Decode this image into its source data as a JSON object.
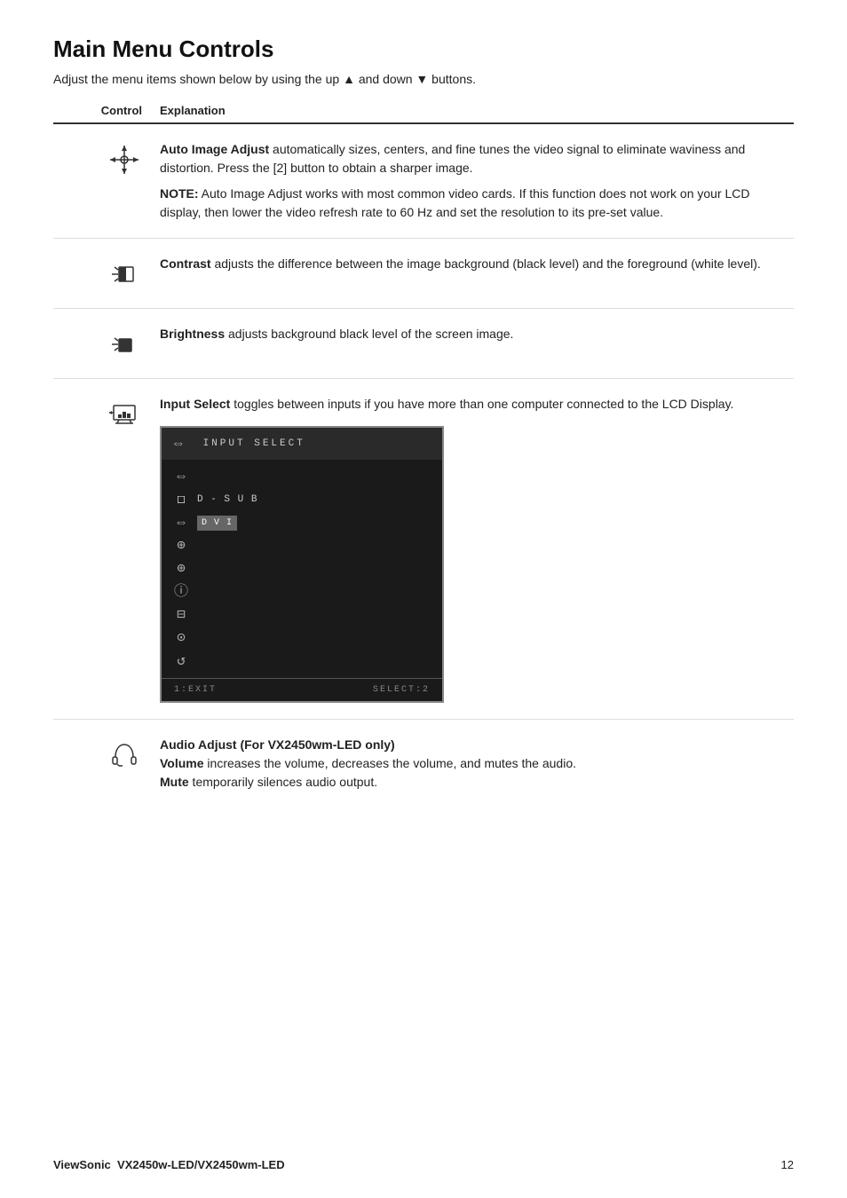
{
  "page": {
    "title": "Main Menu Controls",
    "intro": "Adjust the menu items shown below by using the up ▲ and down ▼ buttons.",
    "table_header": {
      "col1": "Control",
      "col2": "Explanation"
    },
    "rows": [
      {
        "id": "auto-image-adjust",
        "icon": "auto-adjust-icon",
        "text_bold": "Auto Image Adjust",
        "text_main": " automatically sizes, centers, and fine tunes the video signal to eliminate waviness and distortion. Press the [2] button to obtain a sharper image.",
        "note_bold": "NOTE:",
        "note_text": " Auto Image Adjust works with most common video cards. If this function does not work on your LCD display, then lower the video refresh rate to 60 Hz and set the resolution to its pre-set value."
      },
      {
        "id": "contrast",
        "icon": "contrast-icon",
        "text_bold": "Contrast",
        "text_main": " adjusts the difference between the image background (black level) and the foreground (white level)."
      },
      {
        "id": "brightness",
        "icon": "brightness-icon",
        "text_bold": "Brightness",
        "text_main": " adjusts background black level of the screen image."
      },
      {
        "id": "input-select",
        "icon": "input-select-icon",
        "text_bold": "Input Select",
        "text_main": " toggles between inputs if you have more than one computer connected to the LCD Display.",
        "has_osd": true
      },
      {
        "id": "audio-adjust",
        "icon": "audio-adjust-icon",
        "text_bold": "Audio Adjust (For VX2450wm-LED only)",
        "text_volume_bold": "Volume",
        "text_volume": " increases the volume, decreases the volume, and mutes the audio.",
        "text_mute_bold": "Mute",
        "text_mute": " temporarily silences audio output."
      }
    ],
    "osd": {
      "title": "INPUT SELECT",
      "title_icon": "⇔",
      "menu_items": [
        {
          "icon": "⇔",
          "label": ""
        },
        {
          "icon": "☐",
          "label": "D-SUB"
        },
        {
          "icon": "⇔",
          "label": "DVI",
          "selected": true
        },
        {
          "icon": "⊕",
          "label": ""
        },
        {
          "icon": "⊕",
          "label": ""
        },
        {
          "icon": "ⓘ",
          "label": ""
        },
        {
          "icon": "⊟",
          "label": ""
        },
        {
          "icon": "⊙",
          "label": ""
        },
        {
          "icon": "↺",
          "label": ""
        }
      ],
      "footer_left": "1:EXIT",
      "footer_right": "SELECT:2"
    },
    "footer": {
      "brand": "ViewSonic",
      "model": "VX2450w-LED/VX2450wm-LED",
      "page_number": "12"
    }
  }
}
